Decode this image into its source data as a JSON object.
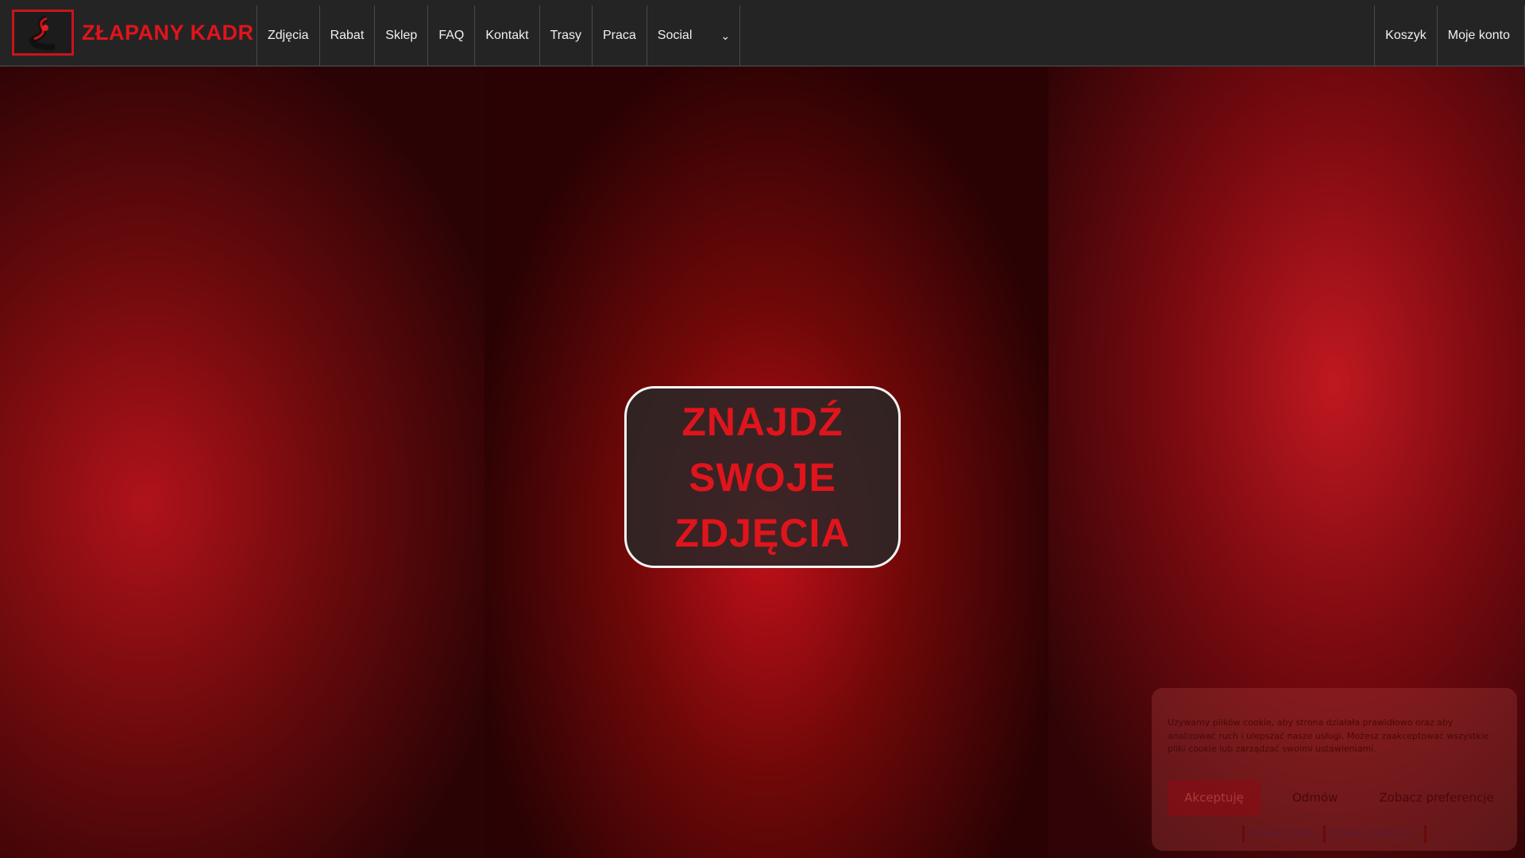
{
  "brand": {
    "name": "ZŁAPANY KADR"
  },
  "nav": {
    "items": [
      "Zdjęcia",
      "Rabat",
      "Sklep",
      "FAQ",
      "Kontakt",
      "Trasy",
      "Praca",
      "Social"
    ],
    "right": [
      "Koszyk",
      "Moje konto"
    ]
  },
  "hero": {
    "line1": "ZNAJDŹ",
    "line2": "SWOJE",
    "line3": "ZDJĘCIA"
  },
  "cookie": {
    "text": "Używamy plików cookie, aby strona działała prawidłowo oraz aby analizować ruch i ulepszać nasze usługi. Możesz zaakceptować wszystkie pliki cookie lub zarządzać swoimi ustawieniami.",
    "accept": "Akceptuję",
    "reject": "Odmów",
    "preferences": "Zobacz preferencje",
    "cookies_policy": "Polityka cookies",
    "privacy_policy": "Polityka prywatności"
  },
  "colors": {
    "accent": "#e0141c",
    "nav_bg": "#242424"
  }
}
